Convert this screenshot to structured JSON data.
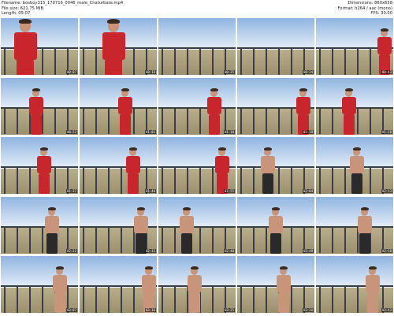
{
  "header": {
    "filename": "Filename: bosboy315_170716_0046_male_Chaturbate.mp4",
    "filesize": "File size: 621.75 MiB",
    "length": "Length: 05:07",
    "dimensions": "Dimensions: 880x658",
    "format": "Format: h264 / aac (mono)",
    "fps": "FPS: 30.00"
  },
  "thumbnails": [
    {
      "time": "00:07",
      "scene": "close"
    },
    {
      "time": "00:16",
      "scene": "close"
    },
    {
      "time": "00:25",
      "scene": "city"
    },
    {
      "time": "00:34",
      "scene": "city"
    },
    {
      "time": "00:43",
      "scene": "balcony"
    },
    {
      "time": "00:52",
      "scene": "sky"
    },
    {
      "time": "01:01",
      "scene": "balcony"
    },
    {
      "time": "01:10",
      "scene": "balcony"
    },
    {
      "time": "01:19",
      "scene": "sky"
    },
    {
      "time": "01:28",
      "scene": "balcony"
    },
    {
      "time": "01:37",
      "scene": "balcony"
    },
    {
      "time": "01:46",
      "scene": "balcony"
    },
    {
      "time": "01:55",
      "scene": "balcony"
    },
    {
      "time": "02:04",
      "scene": "balcony"
    },
    {
      "time": "02:13",
      "scene": "balcony"
    },
    {
      "time": "02:22",
      "scene": "balcony"
    },
    {
      "time": "02:31",
      "scene": "balcony"
    },
    {
      "time": "02:40",
      "scene": "balcony"
    },
    {
      "time": "02:49",
      "scene": "balcony"
    },
    {
      "time": "02:58",
      "scene": "balcony"
    },
    {
      "time": "03:07",
      "scene": "balcony"
    },
    {
      "time": "03:16",
      "scene": "balcony"
    },
    {
      "time": "03:25",
      "scene": "balcony"
    },
    {
      "time": "03:34",
      "scene": "balcony"
    },
    {
      "time": "03:43",
      "scene": "balcony"
    }
  ],
  "colors": {
    "sky_top": "#8fb4e0",
    "sky_bottom": "#e6eef8",
    "ground": "#9b8f6e",
    "shirt": "#c8262c",
    "skin": "#c9957a",
    "shorts": "#2a2a2a"
  }
}
